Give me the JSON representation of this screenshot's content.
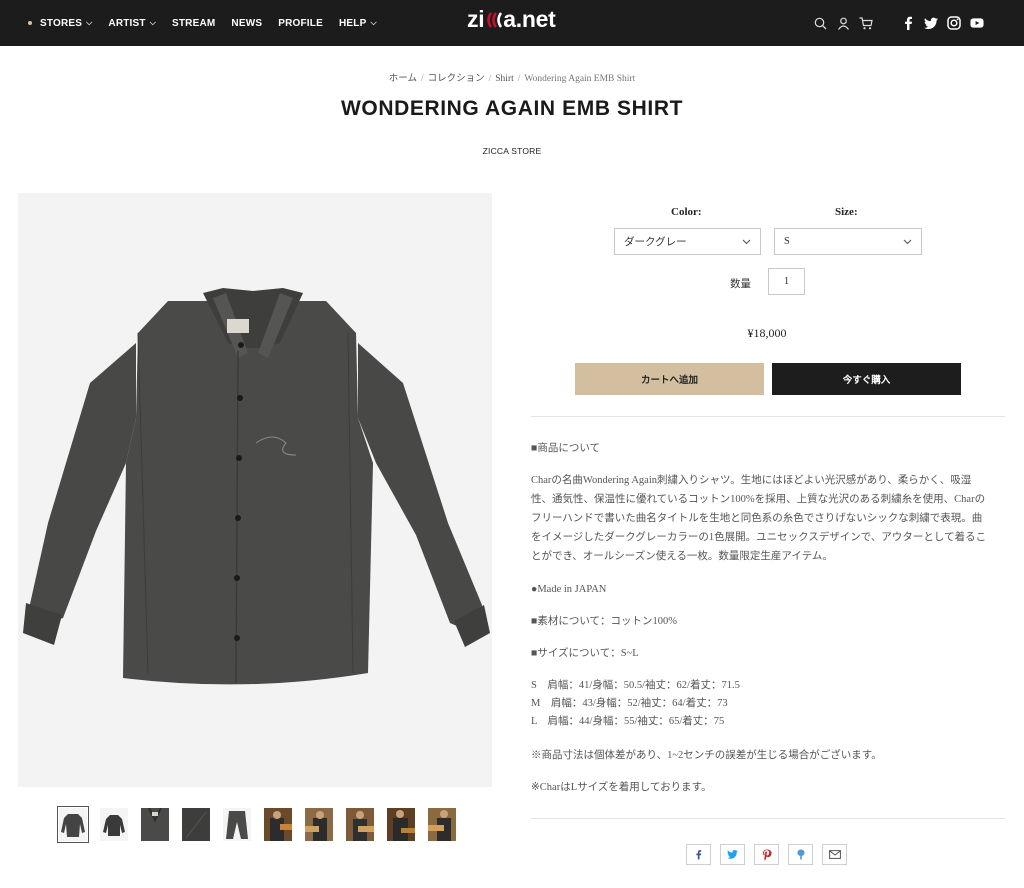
{
  "header": {
    "nav": [
      {
        "label": "STORES",
        "dot": true,
        "caret": true
      },
      {
        "label": "ARTIST",
        "dot": false,
        "caret": true
      },
      {
        "label": "STREAM",
        "dot": false,
        "caret": false
      },
      {
        "label": "NEWS",
        "dot": false,
        "caret": false
      },
      {
        "label": "PROFILE",
        "dot": false,
        "caret": false
      },
      {
        "label": "HELP",
        "dot": false,
        "caret": true
      }
    ],
    "logo_left": "zi",
    "logo_right": "a.net",
    "icons": [
      "search-icon",
      "account-icon",
      "cart-icon",
      "facebook-icon",
      "twitter-icon",
      "instagram-icon",
      "youtube-icon"
    ]
  },
  "breadcrumb": {
    "items": [
      "ホーム",
      "コレクション",
      "Shirt",
      "Wondering Again EMB Shirt"
    ]
  },
  "product": {
    "title": "WONDERING AGAIN EMB SHIRT",
    "vendor": "ZICCA STORE",
    "color_label": "Color:",
    "color_value": "ダークグレー",
    "size_label": "Size:",
    "size_value": "S",
    "qty_label": "数量",
    "qty_value": "1",
    "price": "¥18,000",
    "add_to_cart": "カートへ追加",
    "buy_now": "今すぐ購入"
  },
  "description": {
    "heading": "■商品について",
    "body": [
      "Charの名曲Wondering Again刺繍入りシャツ。生地にはほどよい光沢感があり、柔らかく、吸湿",
      "性、通気性、保温性に優れているコットン100%を採用、上質な光沢のある刺繍糸を使用、Charの",
      "フリーハンドで書いた曲名タイトルを生地と同色系の糸色でさりげないシックな刺繍で表現。曲",
      "をイメージしたダークグレーカラーの1色展開。ユニセックスデザインで、アウターとして着るこ",
      "とができ、オールシーズン使える一枚。数量限定生産アイテム。"
    ],
    "made_in": "●Made in JAPAN",
    "material": "■素材について：コットン100%",
    "size_range": "■サイズについて：S~L",
    "sizes": [
      "S　肩幅：41/身幅：50.5/袖丈：62/着丈：71.5",
      "M　肩幅：43/身幅：52/袖丈：64/着丈：73",
      "L　肩幅：44/身幅：55/袖丈：65/着丈：75"
    ],
    "note1": "※商品寸法は個体差があり、1~2センチの誤差が生じる場合がございます。",
    "note2": "※CharはLサイズを着用しております。"
  },
  "thumbnails": [
    "shirt-front",
    "shirt-folded",
    "collar-detail",
    "fabric-detail",
    "pants-view",
    "model-photo-1",
    "model-photo-2",
    "model-photo-3",
    "model-photo-4",
    "model-photo-5"
  ],
  "share": [
    "facebook-share-icon",
    "twitter-share-icon",
    "pinterest-share-icon",
    "fancy-share-icon",
    "email-share-icon"
  ],
  "colors": {
    "header_bg": "#1c1c1c",
    "accent_tan": "#d3bf9f",
    "logo_red": "#c8102e",
    "shirt": "#4a4a48",
    "twitter": "#1da1f2",
    "facebook": "#3b5998",
    "pinterest": "#cb2027",
    "fancy": "#4999dc"
  }
}
